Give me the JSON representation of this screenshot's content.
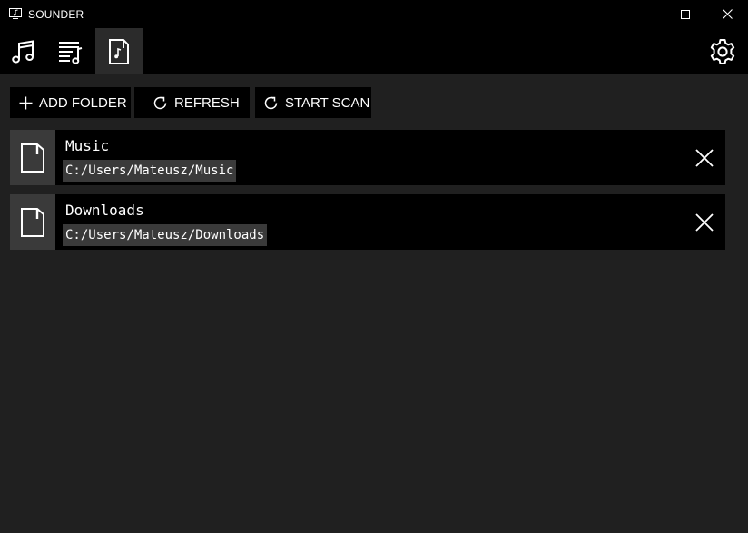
{
  "window": {
    "title": "SOUNDER",
    "icons": {
      "app": "monitor-music-icon",
      "minimize": "minimize-icon",
      "maximize": "maximize-icon",
      "close": "close-icon"
    }
  },
  "nav": {
    "tabs": [
      {
        "id": "songs",
        "icon": "music-note-icon",
        "active": false
      },
      {
        "id": "playlist",
        "icon": "playlist-icon",
        "active": false
      },
      {
        "id": "folders",
        "icon": "music-file-icon",
        "active": true
      }
    ],
    "settings_icon": "gear-icon"
  },
  "toolbar": {
    "add_folder_label": "ADD FOLDER",
    "refresh_label": "REFRESH",
    "start_scan_label": "START SCAN"
  },
  "folders": [
    {
      "name": "Music",
      "path": "C:/Users/Mateusz/Music"
    },
    {
      "name": "Downloads",
      "path": "C:/Users/Mateusz/Downloads"
    }
  ],
  "colors": {
    "background": "#202020",
    "bar": "#000000",
    "active_tab": "#2b2b2b",
    "thumb": "#3a3a3a",
    "text": "#ffffff"
  }
}
